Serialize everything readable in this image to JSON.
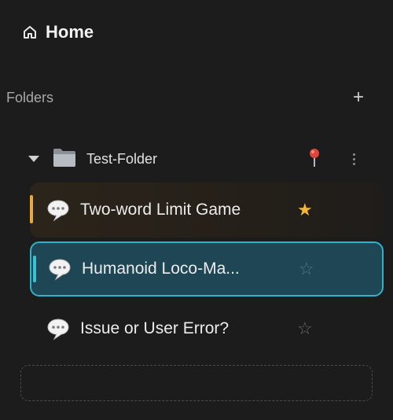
{
  "nav": {
    "home_label": "Home",
    "home_icon": "home-icon"
  },
  "folders": {
    "header_label": "Folders",
    "add_label": "+",
    "items": [
      {
        "name": "Test-Folder",
        "expanded": true,
        "icon": "folder-icon",
        "pinned": true,
        "pin_icon": "pushpin-icon",
        "chats": [
          {
            "title": "Two-word Limit Game",
            "starred": true,
            "state": "starred"
          },
          {
            "title": "Humanoid Loco-Ma...",
            "starred": false,
            "state": "active"
          },
          {
            "title": "Issue or User Error?",
            "starred": false,
            "state": "normal"
          }
        ]
      }
    ]
  },
  "glyphs": {
    "star_filled": "★",
    "star_empty": "☆"
  },
  "colors": {
    "background": "#1c1c1c",
    "active_bg": "#1e4654",
    "active_border": "#2fb3c8",
    "starred_accent": "#e9a93a",
    "star": "#f2b73a"
  }
}
